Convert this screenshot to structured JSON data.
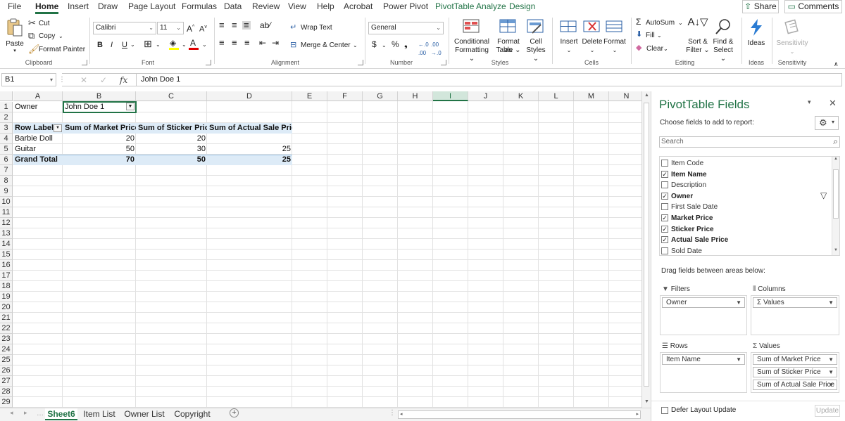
{
  "tabs": [
    "File",
    "Home",
    "Insert",
    "Draw",
    "Page Layout",
    "Formulas",
    "Data",
    "Review",
    "View",
    "Help",
    "Acrobat",
    "Power Pivot",
    "PivotTable Analyze",
    "Design"
  ],
  "share_label": "Share",
  "comments_label": "Comments",
  "ribbon": {
    "clipboard": {
      "paste": "Paste",
      "cut": "Cut",
      "copy": "Copy",
      "format_painter": "Format Painter",
      "group": "Clipboard"
    },
    "font": {
      "name": "Calibri",
      "size": "11",
      "group": "Font",
      "bold": "B",
      "italic": "I",
      "underline": "U"
    },
    "alignment": {
      "wrap_text": "Wrap Text",
      "merge_center": "Merge & Center",
      "group": "Alignment"
    },
    "number": {
      "format": "General",
      "group": "Number",
      "currency": "$",
      "percent": "%"
    },
    "styles": {
      "conditional": "Conditional",
      "formatting": "Formatting",
      "format_as": "Format as",
      "table": "Table",
      "cell": "Cell",
      "cell_styles": "Styles",
      "group": "Styles"
    },
    "cells": {
      "insert": "Insert",
      "delete": "Delete",
      "format": "Format",
      "group": "Cells"
    },
    "editing": {
      "autosum": "AutoSum",
      "fill": "Fill",
      "clear": "Clear",
      "sort": "Sort &",
      "filter": "Filter",
      "find": "Find &",
      "select": "Select",
      "group": "Editing"
    },
    "ideas": {
      "label": "Ideas",
      "group": "Ideas"
    },
    "sensitivity": {
      "label": "Sensitivity",
      "group": "Sensitivity"
    }
  },
  "formula_bar": {
    "namebox": "B1",
    "formula": "John Doe 1",
    "fx": "fx"
  },
  "columns": [
    "A",
    "B",
    "C",
    "D",
    "E",
    "F",
    "G",
    "H",
    "I",
    "J",
    "K",
    "L",
    "M",
    "N"
  ],
  "selected_column": "I",
  "rows": [
    "1",
    "2",
    "3",
    "4",
    "5",
    "6",
    "7",
    "8",
    "9",
    "10",
    "11",
    "12",
    "13",
    "14",
    "15",
    "16",
    "17",
    "18",
    "19",
    "20",
    "21",
    "22",
    "23",
    "24",
    "25",
    "26",
    "27",
    "28",
    "29"
  ],
  "cells": {
    "a1": "Owner",
    "b1": "John Doe 1",
    "a3": "Row Labels",
    "b3": "Sum of Market Price",
    "c3": "Sum of Sticker Price",
    "d3": "Sum of Actual Sale Price",
    "a4": "Barbie Doll",
    "b4": "20",
    "c4": "20",
    "a5": "Guitar",
    "b5": "50",
    "c5": "30",
    "d5": "25",
    "a6": "Grand Total",
    "b6": "70",
    "c6": "50",
    "d6": "25"
  },
  "sheets": [
    "Sheet6",
    "Item List",
    "Owner List",
    "Copyright"
  ],
  "active_sheet": "Sheet6",
  "pivot": {
    "title": "PivotTable Fields",
    "subtitle": "Choose fields to add to report:",
    "search_placeholder": "Search",
    "fields": [
      {
        "name": "Item Code",
        "checked": false
      },
      {
        "name": "Item Name",
        "checked": true
      },
      {
        "name": "Description",
        "checked": false
      },
      {
        "name": "Owner",
        "checked": true
      },
      {
        "name": "First Sale Date",
        "checked": false
      },
      {
        "name": "Market Price",
        "checked": true
      },
      {
        "name": "Sticker Price",
        "checked": true
      },
      {
        "name": "Actual Sale Price",
        "checked": true
      },
      {
        "name": "Sold Date",
        "checked": false
      }
    ],
    "drag_label": "Drag fields between areas below:",
    "areas": {
      "filters": {
        "label": "Filters",
        "items": [
          "Owner"
        ]
      },
      "columns": {
        "label": "Columns",
        "items": [
          "Σ Values"
        ]
      },
      "rows": {
        "label": "Rows",
        "items": [
          "Item Name"
        ]
      },
      "values": {
        "label": "Values",
        "items": [
          "Sum of Market Price",
          "Sum of Sticker Price",
          "Sum of Actual Sale Price"
        ]
      }
    },
    "defer_label": "Defer Layout Update",
    "update_label": "Update"
  },
  "colors": {
    "accent": "#217346",
    "pivot_band": "#ddebf7"
  }
}
